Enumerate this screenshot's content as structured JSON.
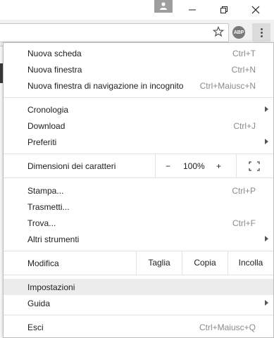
{
  "toolbar": {
    "abp_label": "ABP"
  },
  "menu": {
    "group1": [
      {
        "label": "Nuova scheda",
        "shortcut": "Ctrl+T"
      },
      {
        "label": "Nuova finestra",
        "shortcut": "Ctrl+N"
      },
      {
        "label": "Nuova finestra di navigazione in incognito",
        "shortcut": "Ctrl+Maiusc+N"
      }
    ],
    "group2": [
      {
        "label": "Cronologia",
        "shortcut": ""
      },
      {
        "label": "Download",
        "shortcut": "Ctrl+J"
      },
      {
        "label": "Preferiti",
        "shortcut": ""
      }
    ],
    "zoom": {
      "label": "Dimensioni dei caratteri",
      "minus": "−",
      "value": "100%",
      "plus": "+"
    },
    "group3": [
      {
        "label": "Stampa...",
        "shortcut": "Ctrl+P"
      },
      {
        "label": "Trasmetti...",
        "shortcut": ""
      },
      {
        "label": "Trova...",
        "shortcut": "Ctrl+F"
      },
      {
        "label": "Altri strumenti",
        "shortcut": ""
      }
    ],
    "edit": {
      "label": "Modifica",
      "cut": "Taglia",
      "copy": "Copia",
      "paste": "Incolla"
    },
    "group4": [
      {
        "label": "Impostazioni",
        "shortcut": ""
      },
      {
        "label": "Guida",
        "shortcut": ""
      }
    ],
    "exit": {
      "label": "Esci",
      "shortcut": "Ctrl+Maiusc+Q"
    }
  }
}
